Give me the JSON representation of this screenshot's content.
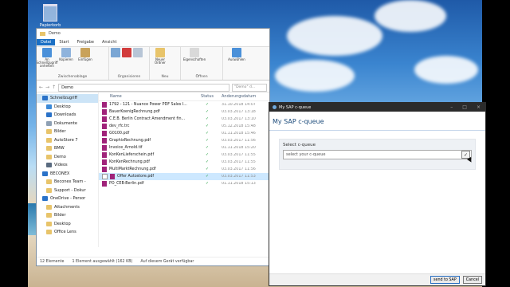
{
  "desktop": {
    "recycle_bin_label": "Papierkorb"
  },
  "explorer": {
    "title": "Demo",
    "tabs": [
      "Datei",
      "Start",
      "Freigabe",
      "Ansicht"
    ],
    "ribbon": {
      "pin_label": "An Schnellzugriff anheften",
      "copy_label": "Kopieren",
      "paste_label": "Einfügen",
      "clipboard_group": "Zwischenablage",
      "organize_group": "Organisieren",
      "new_folder_label": "Neuer Ordner",
      "new_group": "Neu",
      "properties_label": "Eigenschaften",
      "open_group": "Öffnen",
      "select_label": "Auswählen"
    },
    "address": "Demo",
    "search_placeholder": "\"Demo\" d...",
    "nav": [
      {
        "label": "Schnellzugriff",
        "color": "#2a72c8",
        "sub": false,
        "sel": true
      },
      {
        "label": "Desktop",
        "color": "#3c8ad8",
        "sub": true
      },
      {
        "label": "Downloads",
        "color": "#2a72c8",
        "sub": true
      },
      {
        "label": "Dokumente",
        "color": "#8ea0b4",
        "sub": true
      },
      {
        "label": "Bilder",
        "color": "#e8c46a",
        "sub": true
      },
      {
        "label": "AutoStore 7",
        "color": "#e8c46a",
        "sub": true
      },
      {
        "label": "BMW",
        "color": "#e8c46a",
        "sub": true
      },
      {
        "label": "Demo",
        "color": "#e8c46a",
        "sub": true
      },
      {
        "label": "Videos",
        "color": "#5a6b80",
        "sub": true
      },
      {
        "label": "BECONEX",
        "color": "#2a72c8",
        "sub": false
      },
      {
        "label": "Beconex Team -",
        "color": "#e8c46a",
        "sub": true
      },
      {
        "label": "Support - Dokur",
        "color": "#e8c46a",
        "sub": true
      },
      {
        "label": "OneDrive - Persor",
        "color": "#2a72c8",
        "sub": false
      },
      {
        "label": "Attachments",
        "color": "#e8c46a",
        "sub": true
      },
      {
        "label": "Bilder",
        "color": "#e8c46a",
        "sub": true
      },
      {
        "label": "Desktop",
        "color": "#e8c46a",
        "sub": true
      },
      {
        "label": "Office Lens",
        "color": "#e8c46a",
        "sub": true
      }
    ],
    "columns": {
      "name": "Name",
      "status": "Status",
      "date": "Änderungsdatum"
    },
    "files": [
      {
        "name": "1792 - 121 - Nuance Power PDF Sales I...",
        "date": "31.10.2018 14:07",
        "sel": false
      },
      {
        "name": "BauerKoenigRechnung.pdf",
        "date": "03.03.2017 13:18",
        "sel": false
      },
      {
        "name": "C.E.B. Berlin Contract Amendment fin...",
        "date": "03.03.2017 13:10",
        "sel": false
      },
      {
        "name": "dev_rfc.trc",
        "date": "05.12.2018 15:48",
        "sel": false
      },
      {
        "name": "G0100.pdf",
        "date": "01.11.2018 15:46",
        "sel": false
      },
      {
        "name": "GraphixRechnung.pdf",
        "date": "03.03.2017 11:56",
        "sel": false
      },
      {
        "name": "Invoice_Arnold.tif",
        "date": "01.11.2018 15:20",
        "sel": false
      },
      {
        "name": "KonKenLieferschein.pdf",
        "date": "03.03.2017 11:55",
        "sel": false
      },
      {
        "name": "KonKenRechnung.pdf",
        "date": "03.03.2017 11:55",
        "sel": false
      },
      {
        "name": "MultiMarktRechnung.pdf",
        "date": "03.03.2017 11:56",
        "sel": false
      },
      {
        "name": "Offer Autostore.pdf",
        "date": "03.03.2017 11:53",
        "sel": true
      },
      {
        "name": "PO_CEB-Berlin.pdf",
        "date": "01.11.2018 15:13",
        "sel": false
      }
    ],
    "status": {
      "count": "12 Elemente",
      "selected": "1 Element ausgewählt (162 KB)",
      "available": "Auf diesem Gerät verfügbar"
    }
  },
  "sap_dialog": {
    "window_title": "My SAP c-queue",
    "heading": "My SAP c-queue",
    "select_label": "Select c-queue",
    "select_placeholder": "select your c-queue",
    "send_button": "send to SAP",
    "cancel_button": "Cancel"
  }
}
